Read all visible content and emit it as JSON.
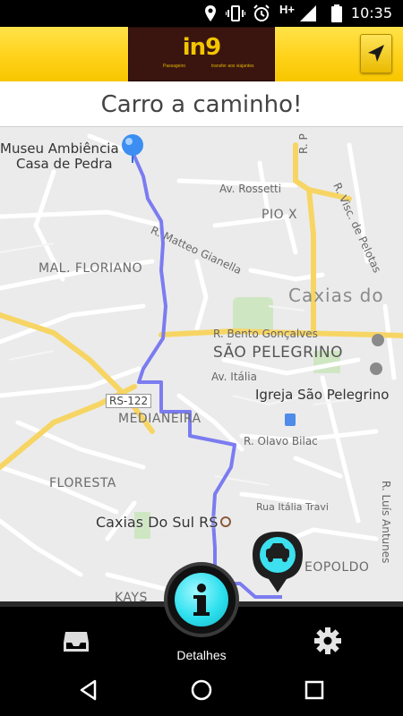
{
  "status_bar": {
    "time": "10:35",
    "network": "H+",
    "icons": [
      "location-icon",
      "vibrate-icon",
      "alarm-icon",
      "signal-icon",
      "battery-icon"
    ]
  },
  "header": {
    "logo_text": "in9",
    "logo_tagline_left": "Passageiro",
    "logo_tagline_right": "transfer aos viajantes",
    "locate_icon": "navigation-arrow-icon"
  },
  "title": "Carro a caminho!",
  "map": {
    "poi_museum_line1": "Museu Ambiência",
    "poi_museum_line2": "Casa de Pedra",
    "street_rossetti": "Av. Rossetti",
    "street_matteo": "R. Matteo Gianella",
    "street_visc": "R. Visc. de Pelotas",
    "street_p": "R. P",
    "street_bento": "R. Bento Gonçalves",
    "street_italia": "Av. Itália",
    "street_olavo": "R. Olavo Bilac",
    "street_travi": "Rua Itália Travi",
    "street_luis": "R. Luís Antunes",
    "district_pio": "PIO X",
    "district_floriano": "MAL. FLORIANO",
    "district_pelegrino": "SÃO PELEGRINO",
    "district_medianeira": "MEDIANEIRA",
    "district_floresta": "FLORESTA",
    "district_leopoldo": "EOPOLDO",
    "district_kays": "KAYS",
    "city_partial": "Caxias do",
    "poi_igreja": "Igreja São Pelegrino",
    "poi_caxias": "Caxias Do Sul RS",
    "highway": "RS-122",
    "route_color": "#7b7cf0",
    "road_yellow": "#f7d564"
  },
  "bottom_nav": {
    "left_icon": "inbox-icon",
    "center_label": "Detalhes",
    "center_icon": "info-icon",
    "right_icon": "settings-gear-icon",
    "accent": "#2ee0ee"
  },
  "system_nav": {
    "back_icon": "back-icon",
    "home_icon": "home-icon",
    "recents_icon": "recents-icon"
  }
}
